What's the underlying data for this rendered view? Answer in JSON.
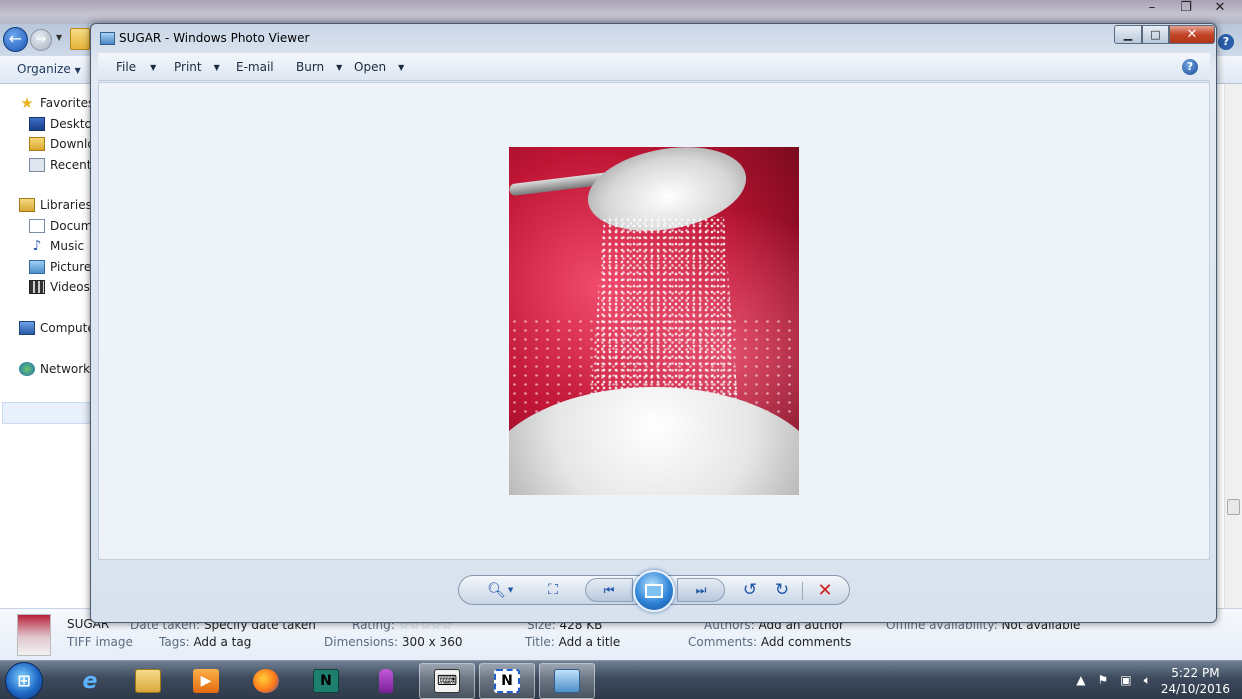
{
  "explorer": {
    "organize_label": "Organize",
    "nav": {
      "favorites": "Favorites",
      "desktop": "Desktop",
      "downloads": "Downlo",
      "recent": "Recent P",
      "libraries": "Libraries",
      "documents": "Docume",
      "music": "Music",
      "pictures": "Pictures",
      "videos": "Videos",
      "computer": "Compute",
      "network": "Network"
    },
    "details": {
      "file_name": "SUGAR",
      "file_type": "TIFF image",
      "date_taken_label": "Date taken:",
      "date_taken_value": "Specify date taken",
      "tags_label": "Tags:",
      "tags_value": "Add a tag",
      "rating_label": "Rating:",
      "dimensions_label": "Dimensions:",
      "dimensions_value": "300 x 360",
      "size_label": "Size:",
      "size_value": "428 KB",
      "title_label": "Title:",
      "title_value": "Add a title",
      "authors_label": "Authors:",
      "authors_value": "Add an author",
      "comments_label": "Comments:",
      "comments_value": "Add comments",
      "offline_label": "Offline availability:",
      "offline_value": "Not available"
    }
  },
  "photo_viewer": {
    "title": "SUGAR - Windows Photo Viewer",
    "menu": {
      "file": "File",
      "print": "Print",
      "email": "E-mail",
      "burn": "Burn",
      "open": "Open"
    },
    "help_glyph": "?",
    "image_subject": "sugar pouring from a spoon"
  },
  "taskbar": {
    "clock_time": "5:22 PM",
    "clock_date": "24/10/2016",
    "apps": [
      "internet-explorer",
      "windows-explorer",
      "media-player",
      "firefox",
      "app-n1",
      "app-purple",
      "app-typewriter",
      "app-n2",
      "photo-viewer"
    ]
  }
}
